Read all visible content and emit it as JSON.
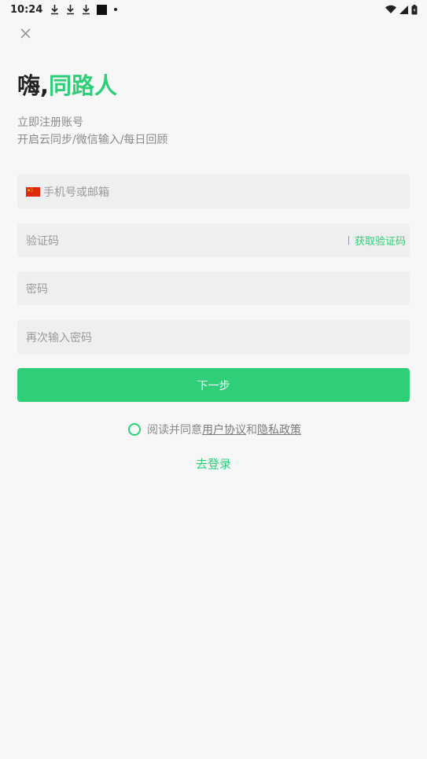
{
  "status_bar": {
    "time": "10:24",
    "left_icons": [
      "download-icon",
      "download-icon",
      "download-icon",
      "square-icon",
      "dot-icon"
    ],
    "right_icons": [
      "wifi-icon",
      "cell-signal-icon",
      "battery-icon"
    ]
  },
  "header": {
    "close_icon": "close-icon",
    "title_prefix": "嗨,",
    "title_accent": "同路人",
    "accent_color": "#2fcf79"
  },
  "subtitle": {
    "line1": "立即注册账号",
    "line2": "开启云同步/微信输入/每日回顾"
  },
  "form": {
    "account_placeholder": "手机号或邮箱",
    "country_flag": "china-flag-icon",
    "code_placeholder": "验证码",
    "get_code_label": "获取验证码",
    "password_placeholder": "密码",
    "confirm_placeholder": "再次输入密码"
  },
  "actions": {
    "next_label": "下一步",
    "agree_prefix": "阅读并同意",
    "user_agreement": "用户协议",
    "agree_and": "和",
    "privacy_policy": "隐私政策",
    "login_label": "去登录"
  }
}
